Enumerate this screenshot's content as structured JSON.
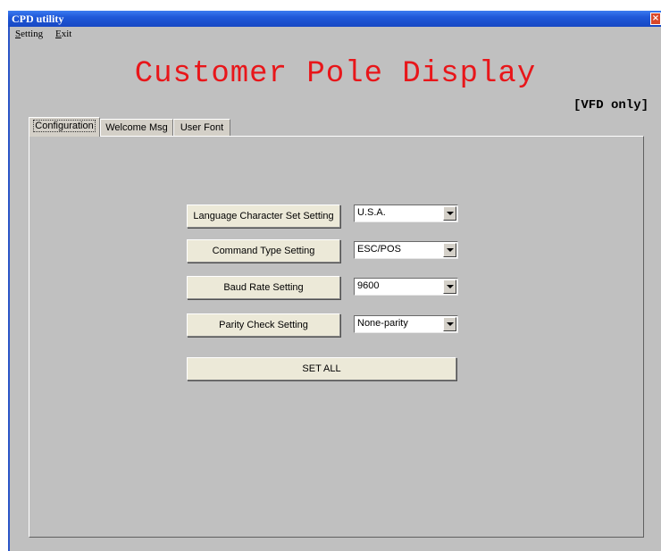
{
  "window": {
    "title": "CPD utility",
    "close_label": "×"
  },
  "menu": {
    "setting": {
      "key": "S",
      "rest": "etting"
    },
    "exit": {
      "key": "E",
      "rest": "xit"
    }
  },
  "header": {
    "title": "Customer Pole Display",
    "note": "[VFD only]"
  },
  "tabs": [
    {
      "label": "Configuration",
      "active": true
    },
    {
      "label": "Welcome Msg",
      "active": false
    },
    {
      "label": "User Font",
      "active": false
    }
  ],
  "settings": [
    {
      "button": "Language Character Set Setting",
      "value": "U.S.A."
    },
    {
      "button": "Command Type Setting",
      "value": "ESC/POS"
    },
    {
      "button": "Baud Rate Setting",
      "value": "9600"
    },
    {
      "button": "Parity Check Setting",
      "value": "None-parity"
    }
  ],
  "set_all_label": "SET ALL"
}
